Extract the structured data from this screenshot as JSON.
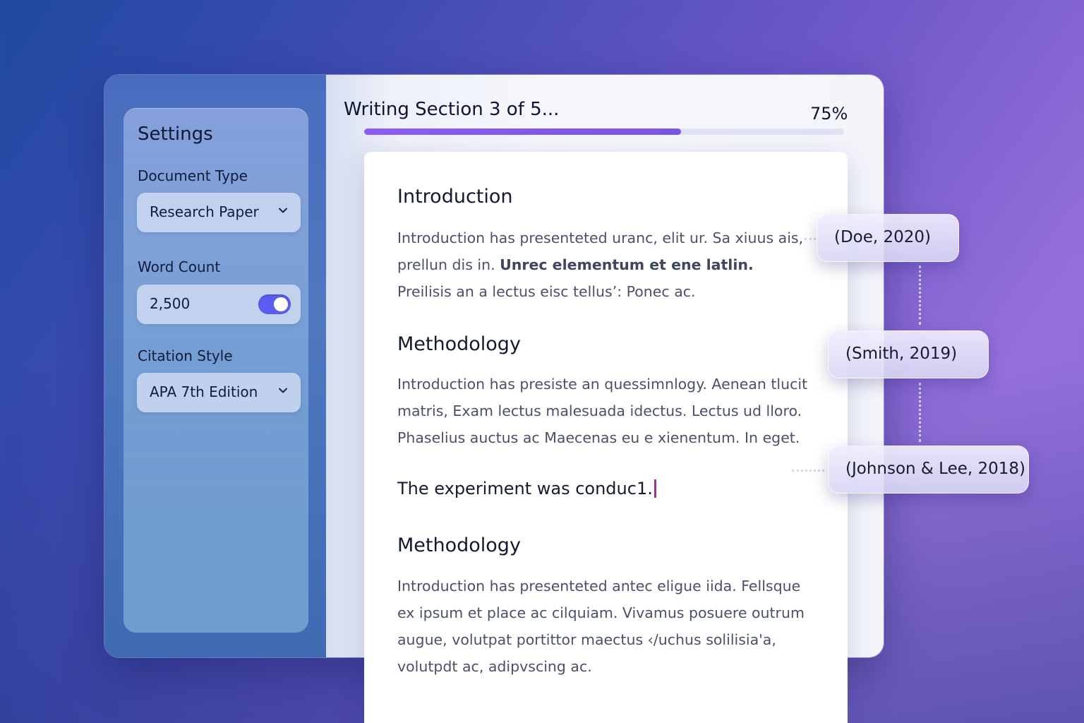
{
  "settings": {
    "title": "Settings",
    "document_type": {
      "label": "Document Type",
      "value": "Research Paper"
    },
    "word_count": {
      "label": "Word Count",
      "value": "2,500",
      "toggle_on": true
    },
    "citation_style": {
      "label": "Citation Style",
      "value": "APA 7th Edition"
    }
  },
  "progress": {
    "title": "Writing Section 3 of 5...",
    "percent_label": "75%",
    "fill_fraction": 0.66
  },
  "document": {
    "sections": [
      {
        "heading": "Introduction",
        "lines": [
          "Introduction has presenteted uranc, elit ur. Sa xiuus ais,",
          "prellun dis in. ",
          "Unrec elementum et ene latlin.",
          "Preilisis an a lectus eisc tellus’: Ponec ac."
        ]
      },
      {
        "heading": "Methodology",
        "lines": [
          "Introduction has presiste an quessimnlogy. Aenean tlucit",
          "matris, Exam lectus malesuada idectus. Lectus ud lloro.",
          "Phaselius auctus ac Maecenas eu e xienentum. In eget."
        ]
      },
      {
        "heading": "Methodology",
        "lines": [
          "Introduction has presenteted antec eligue iida. Fellsque",
          "ex ipsum et place ac cilquiam. Vivamus posuere outrum",
          "augue, volutpat portittor maectus ‹/uchus solilisia'a,",
          "volutpdt ac, adipvscing ac."
        ]
      }
    ],
    "typing_line": "The experiment was conduc1."
  },
  "citations": [
    "(Doe, 2020)",
    "(Smith, 2019)",
    "(Johnson & Lee, 2018)"
  ],
  "colors": {
    "accent": "#7a55e6",
    "toggle": "#5b5cf0",
    "cursor": "#a7308a"
  },
  "icons": {
    "dropdown": "chevron-down-icon"
  }
}
